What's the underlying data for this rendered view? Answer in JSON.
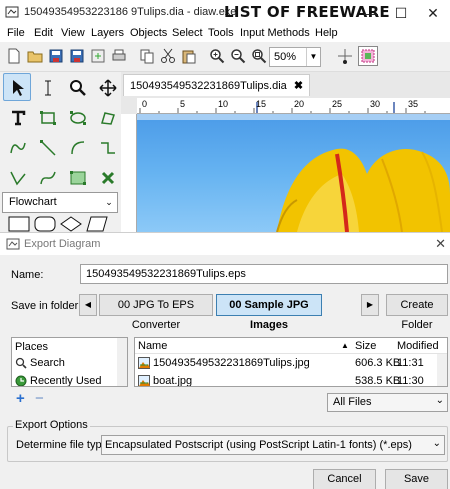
{
  "window": {
    "title": "15049354953223186 9Tulips.dia - diaw.exe",
    "watermark": "LIST OF FREEWARE",
    "minimize": "—",
    "maximize": "☐",
    "close": "✕"
  },
  "menu": [
    "File",
    "Edit",
    "View",
    "Layers",
    "Objects",
    "Select",
    "Tools",
    "Input Methods",
    "Help"
  ],
  "toolbar": {
    "zoom_value": "50%"
  },
  "toolbox": {
    "sheet_selected": "Flowchart"
  },
  "document": {
    "tab_label": "150493549532231869Tulips.dia",
    "tab_close": "✖",
    "ruler_labels": [
      "0",
      "5",
      "10",
      "15",
      "20",
      "25",
      "30",
      "35"
    ]
  },
  "dialog": {
    "title": "Export Diagram",
    "close": "✕",
    "name_label": "Name:",
    "name_value": "150493549532231869Tulips.eps",
    "folder_label": "Save in folder:",
    "path_left_arrow": "◀",
    "path_right_arrow": "▶",
    "path_items": [
      "00 JPG To EPS Converter",
      "00 Sample JPG Images"
    ],
    "create_folder": "Create Folder",
    "places_header": "Places",
    "places": [
      "Search",
      "Recently Used"
    ],
    "add_icon": "+",
    "remove_icon": "−",
    "columns": {
      "name": "Name",
      "size": "Size",
      "modified": "Modified"
    },
    "sort_indicator": "▲",
    "files": [
      {
        "name": "150493549532231869Tulips.jpg",
        "size": "606.3 KB",
        "modified": "11:31"
      },
      {
        "name": "boat.jpg",
        "size": "538.5 KB",
        "modified": "11:30"
      }
    ],
    "filter": "All Files",
    "export_options_label": "Export Options",
    "filetype_label": "Determine file type:",
    "filetype_value": "Encapsulated Postscript (using PostScript Latin-1 fonts) (*.eps)",
    "cancel": "Cancel",
    "save": "Save"
  }
}
